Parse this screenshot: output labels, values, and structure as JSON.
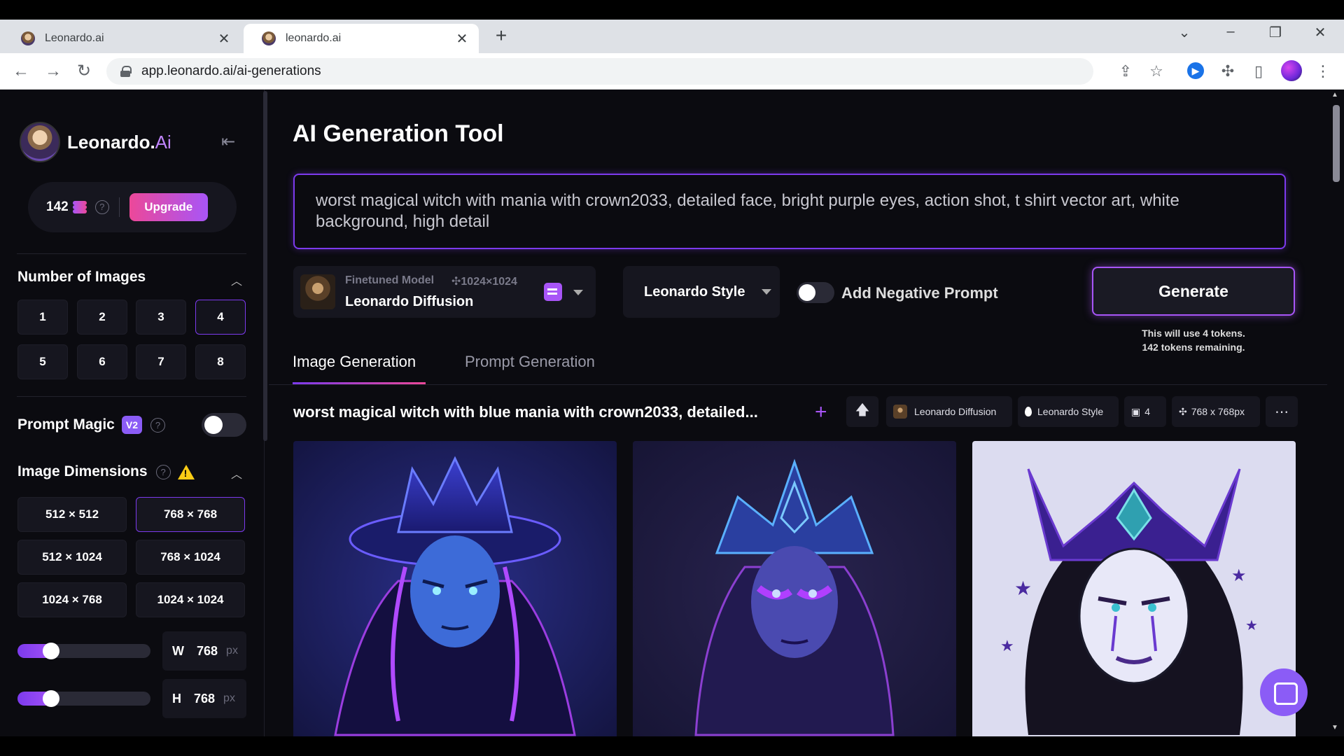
{
  "browser": {
    "tabs": [
      {
        "title": "Leonardo.ai",
        "active": false
      },
      {
        "title": "leonardo.ai",
        "active": true
      }
    ],
    "url": "app.leonardo.ai/ai-generations",
    "icons": [
      "back-arrow-icon",
      "forward-arrow-icon",
      "reload-icon",
      "lock-icon",
      "share-icon",
      "star-icon",
      "extension-icon",
      "puzzle-icon",
      "sidepanel-icon",
      "profile-avatar",
      "kebab-menu-icon"
    ]
  },
  "sidebar": {
    "brand": {
      "name": "Leonardo.",
      "suffix": "Ai"
    },
    "tokens": {
      "count": "142",
      "upgrade_label": "Upgrade"
    },
    "number_of_images": {
      "title": "Number of Images",
      "options": [
        "1",
        "2",
        "3",
        "4",
        "5",
        "6",
        "7",
        "8"
      ],
      "selected": "4"
    },
    "prompt_magic": {
      "title": "Prompt Magic",
      "badge": "V2",
      "enabled": false
    },
    "image_dimensions": {
      "title": "Image Dimensions",
      "options": [
        "512 × 512",
        "768 × 768",
        "512 × 1024",
        "768 × 1024",
        "1024 × 768",
        "1024 × 1024"
      ],
      "selected": "768 × 768",
      "width": {
        "label": "W",
        "value": "768",
        "unit": "px"
      },
      "height": {
        "label": "H",
        "value": "768",
        "unit": "px"
      }
    }
  },
  "main": {
    "title": "AI Generation Tool",
    "prompt": "worst magical witch with mania with crown2033, detailed face, bright purple eyes, action shot, t shirt vector art, white background, high detail",
    "model": {
      "sub": "Finetuned Model",
      "size": "1024×1024",
      "name": "Leonardo Diffusion"
    },
    "style": "Leonardo Style",
    "negative_prompt_label": "Add Negative Prompt",
    "generate_label": "Generate",
    "token_note_1": "This will use 4 tokens.",
    "token_note_2": "142 tokens remaining.",
    "tabs": [
      {
        "label": "Image Generation",
        "active": true
      },
      {
        "label": "Prompt Generation",
        "active": false
      }
    ],
    "generation": {
      "prompt": "worst magical witch with blue mania with crown2033, detailed...",
      "model": "Leonardo Diffusion",
      "style": "Leonardo Style",
      "count": "4",
      "size": "768 x 768px"
    }
  },
  "colors": {
    "accent": "#7c3aed",
    "pink": "#ec4899",
    "bg": "#0b0b10"
  }
}
